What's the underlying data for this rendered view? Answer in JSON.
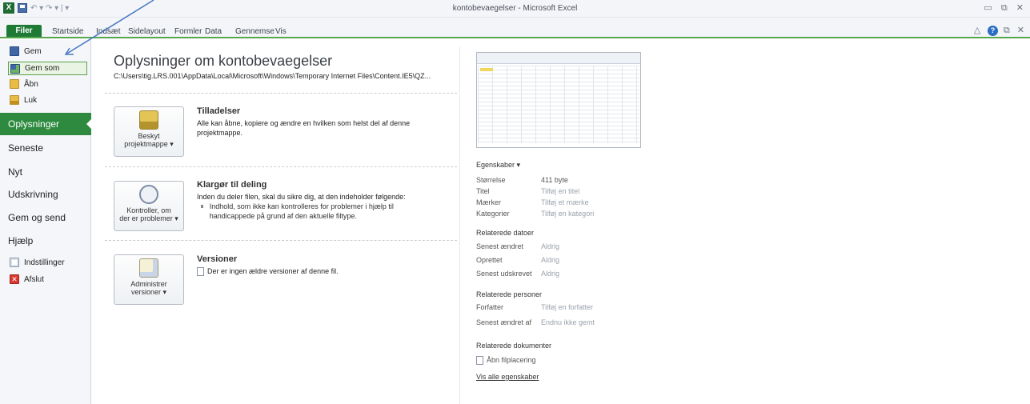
{
  "window": {
    "title": "kontobevaegelser - Microsoft Excel",
    "logo_letter": "X",
    "qat_glyphs": "↶ ▾ ↷ ▾ | ▾",
    "controls": "▭ ⧉ ✕",
    "ribbon_controls": "△ ▭ ⧉ ✕",
    "help_glyph": "?"
  },
  "ribbon": {
    "file": "Filer",
    "tabs": [
      "Startside",
      "Indsæt",
      "Sidelayout",
      "Formler",
      "Data",
      "Gennemse",
      "Vis"
    ]
  },
  "sidebar": {
    "small": [
      {
        "label": "Gem",
        "icon": "save-icon"
      },
      {
        "label": "Gem som",
        "icon": "save-as-icon"
      },
      {
        "label": "Åbn",
        "icon": "open-folder-icon"
      },
      {
        "label": "Luk",
        "icon": "close-folder-icon"
      }
    ],
    "info": "Oplysninger",
    "big": [
      "Seneste",
      "Nyt",
      "Udskrivning",
      "Gem og send",
      "Hjælp"
    ],
    "bottom": [
      {
        "label": "Indstillinger",
        "icon": "options-icon"
      },
      {
        "label": "Afslut",
        "icon": "exit-icon"
      }
    ],
    "exit_glyph": "✕"
  },
  "main": {
    "title": "Oplysninger om kontobevaegelser",
    "path": "C:\\Users\\tig.LRS.001\\AppData\\Local\\Microsoft\\Windows\\Temporary Internet Files\\Content.IE5\\QZ...",
    "sections": [
      {
        "button_line1": "Beskyt",
        "button_line2": "projektmappe ▾",
        "heading": "Tilladelser",
        "text": "Alle kan åbne, kopiere og ændre en hvilken som helst del af denne projektmappe."
      },
      {
        "button_line1": "Kontroller, om",
        "button_line2": "der er problemer ▾",
        "heading": "Klargør til deling",
        "text": "Inden du deler filen, skal du sikre dig, at den indeholder følgende:",
        "bullet": "Indhold, som ikke kan kontrolleres for problemer i hjælp til handicappede på grund af den aktuelle filtype."
      },
      {
        "button_line1": "Administrer",
        "button_line2": "versioner ▾",
        "heading": "Versioner",
        "text": "Der er ingen ældre versioner af denne fil."
      }
    ]
  },
  "properties": {
    "header": "Egenskaber ▾",
    "rows": [
      {
        "k": "Størrelse",
        "v": "411 byte"
      },
      {
        "k": "Titel",
        "v": "Tilføj en titel"
      },
      {
        "k": "Mærker",
        "v": "Tilføj et mærke"
      },
      {
        "k": "Kategorier",
        "v": "Tilføj en kategori"
      }
    ],
    "dates_header": "Relaterede datoer",
    "dates": [
      {
        "k": "Senest ændret",
        "v": "Aldrig"
      },
      {
        "k": "Oprettet",
        "v": "Aldrig"
      },
      {
        "k": "Senest udskrevet",
        "v": "Aldrig"
      }
    ],
    "people_header": "Relaterede personer",
    "people": [
      {
        "k": "Forfatter",
        "v": "Tilføj en forfatter"
      },
      {
        "k": "Senest ændret af",
        "v": "Endnu ikke gemt"
      }
    ],
    "docs_header": "Relaterede dokumenter",
    "open_location": "Åbn filplacering",
    "show_all": "Vis alle egenskaber"
  }
}
